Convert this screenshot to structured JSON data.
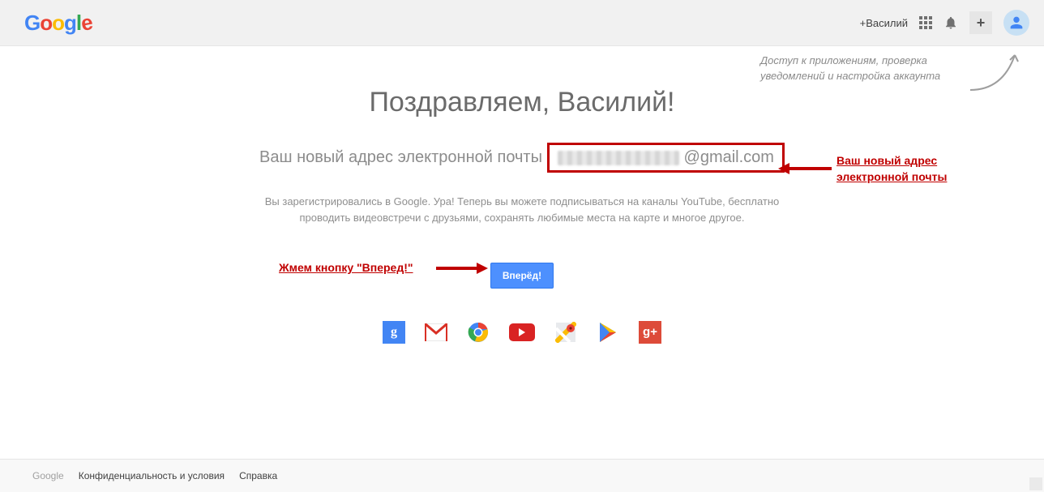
{
  "header": {
    "plus_name": "+Василий"
  },
  "hint": {
    "text": "Доступ к приложениям, проверка уведомлений и настройка аккаунта"
  },
  "main": {
    "title": "Поздравляем, Василий!",
    "email_label": "Ваш новый адрес электронной почты",
    "email_suffix": "@gmail.com",
    "desc_line1": "Вы зарегистрировались в Google. Ура! Теперь вы можете подписываться на каналы YouTube, бесплатно",
    "desc_line2": "проводить видеовстречи с друзьями, сохранять любимые места на карте и многое другое.",
    "forward_button": "Вперёд!"
  },
  "annotations": {
    "email": "Ваш новый адрес электронной почты",
    "press_button": "Жмем кнопку \"Вперед!\""
  },
  "footer": {
    "google": "Google",
    "privacy": "Конфиденциальность и условия",
    "help": "Справка"
  },
  "product_icons": {
    "g": "g",
    "gplus": "g+"
  }
}
